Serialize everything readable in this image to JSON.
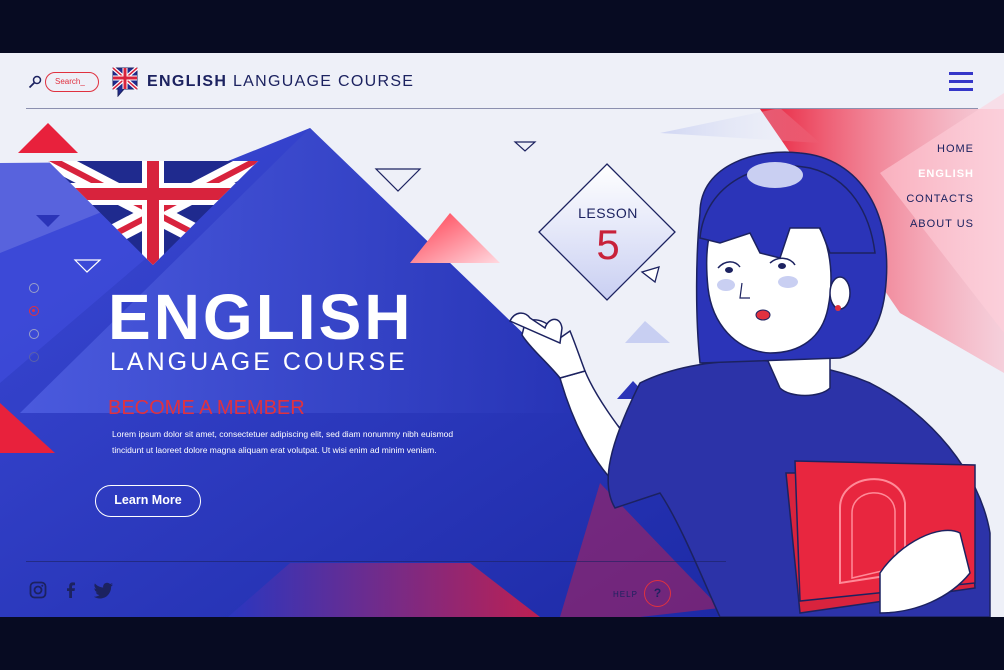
{
  "header": {
    "search_placeholder": "Search_",
    "brand_bold": "ENGLISH",
    "brand_rest": " LANGUAGE COURSE"
  },
  "nav": {
    "items": [
      {
        "label": "HOME",
        "active": false
      },
      {
        "label": "ENGLISH",
        "active": true
      },
      {
        "label": "CONTACTS",
        "active": false
      },
      {
        "label": "ABOUT US",
        "active": false
      }
    ]
  },
  "slider": {
    "count": 4,
    "active_index": 1
  },
  "hero": {
    "title": "ENGLISH",
    "subtitle": "LANGUAGE COURSE",
    "cta_heading": "BECOME A MEMBER",
    "body_line1": "Lorem ipsum dolor sit amet, consectetuer adipiscing elit, sed diam nonummy nibh euismod",
    "body_line2": "tincidunt ut laoreet dolore magna aliquam erat volutpat. Ut wisi enim ad minim veniam.",
    "button_label": "Learn More"
  },
  "lesson": {
    "label": "LESSON",
    "number": "5"
  },
  "footer": {
    "social": [
      "instagram-icon",
      "facebook-icon",
      "twitter-icon"
    ],
    "help_label": "HELP",
    "help_symbol": "?"
  },
  "colors": {
    "brand_blue": "#2b34b8",
    "accent_red": "#e0313f",
    "navy_text": "#1c2260",
    "background": "#eef0f8",
    "frame": "#070b22"
  }
}
